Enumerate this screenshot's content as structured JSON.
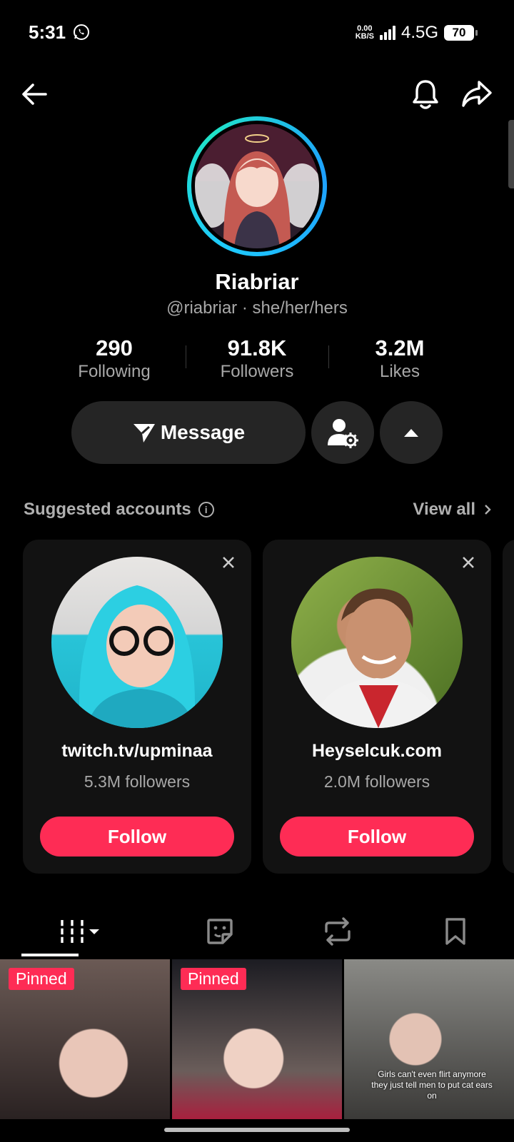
{
  "status": {
    "time": "5:31",
    "speed": "0.00",
    "speed_unit": "KB/S",
    "network": "4.5G",
    "battery": "70"
  },
  "profile": {
    "name": "Riabriar",
    "handle": "@riabriar · she/her/hers",
    "stats": [
      {
        "value": "290",
        "label": "Following"
      },
      {
        "value": "91.8K",
        "label": "Followers"
      },
      {
        "value": "3.2M",
        "label": "Likes"
      }
    ],
    "message_label": "Message"
  },
  "suggested": {
    "title": "Suggested accounts",
    "view_all": "View all",
    "accounts": [
      {
        "name": "twitch.tv/upminaa",
        "followers": "5.3M followers",
        "button": "Follow"
      },
      {
        "name": "Heyselcuk.com",
        "followers": "2.0M followers",
        "button": "Follow"
      }
    ]
  },
  "videos": {
    "items": [
      {
        "badge": "Pinned"
      },
      {
        "badge": "Pinned"
      },
      {
        "caption": "Girls can't even flirt anymore they just tell men to put cat ears on"
      }
    ]
  },
  "colors": {
    "accent": "#fe2c55",
    "ring": "#1ec8ff"
  },
  "icons": [
    "whatsapp-icon",
    "back-arrow-icon",
    "bell-icon",
    "share-icon",
    "send-icon",
    "friend-settings-icon",
    "caret-up-icon",
    "info-icon",
    "chevron-right-icon",
    "close-icon",
    "grid-icon",
    "sticker-icon",
    "repost-icon",
    "bookmark-icon"
  ]
}
